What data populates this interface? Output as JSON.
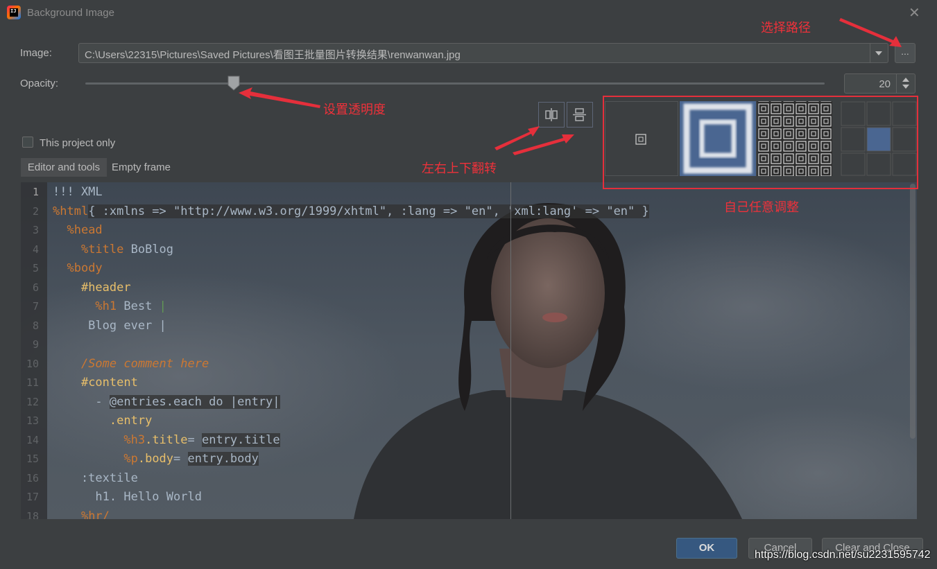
{
  "window": {
    "title": "Background Image",
    "app_icon": "intellij-logo",
    "app_icon_text": "IJ",
    "close_glyph": "✕"
  },
  "image": {
    "label": "Image:",
    "path": "C:\\Users\\22315\\Pictures\\Saved Pictures\\看图王批量图片转换结果\\renwanwan.jpg",
    "browse_label": "..."
  },
  "opacity": {
    "label": "Opacity:",
    "value": "20",
    "slider_fraction": 0.2
  },
  "flip": {
    "horizontal_icon": "flip-horizontal-icon",
    "vertical_icon": "flip-vertical-icon"
  },
  "fill_modes": [
    "center",
    "scale",
    "tile",
    "plain-grid"
  ],
  "annotations": {
    "select_path": "选择路径",
    "set_opacity": "设置透明度",
    "flip": "左右上下翻转",
    "adjust": "自己任意调整"
  },
  "project_only": {
    "label": "This project only",
    "checked": false
  },
  "tabs": {
    "editor": "Editor and tools",
    "frame": "Empty frame"
  },
  "code_lines": [
    {
      "n": "1",
      "segments": [
        {
          "t": "!!! XML",
          "c": "c-default"
        }
      ]
    },
    {
      "n": "2",
      "segments": [
        {
          "t": "%html",
          "c": "c-pct"
        },
        {
          "t": "{ :xmlns => \"http://www.w3.org/1999/xhtml\", :lang => \"en\", 'xml:lang' => \"en\" }",
          "c": "c-default hl"
        }
      ]
    },
    {
      "n": "3",
      "segments": [
        {
          "t": "  ",
          "c": "c-default"
        },
        {
          "t": "%head",
          "c": "c-pct"
        }
      ]
    },
    {
      "n": "4",
      "segments": [
        {
          "t": "    ",
          "c": "c-default"
        },
        {
          "t": "%title",
          "c": "c-pct"
        },
        {
          "t": " BoBlog",
          "c": "c-default"
        }
      ]
    },
    {
      "n": "5",
      "segments": [
        {
          "t": "  ",
          "c": "c-default"
        },
        {
          "t": "%body",
          "c": "c-pct"
        }
      ]
    },
    {
      "n": "6",
      "segments": [
        {
          "t": "    ",
          "c": "c-default"
        },
        {
          "t": "#header",
          "c": "c-tag"
        }
      ]
    },
    {
      "n": "7",
      "segments": [
        {
          "t": "      ",
          "c": "c-default"
        },
        {
          "t": "%h1",
          "c": "c-pct"
        },
        {
          "t": " Best ",
          "c": "c-default"
        },
        {
          "t": "|",
          "c": "c-green"
        }
      ]
    },
    {
      "n": "8",
      "segments": [
        {
          "t": "     Blog ever ",
          "c": "c-default"
        },
        {
          "t": "|",
          "c": "c-default"
        }
      ]
    },
    {
      "n": "9",
      "segments": [
        {
          "t": "",
          "c": "c-default"
        }
      ]
    },
    {
      "n": "10",
      "segments": [
        {
          "t": "    ",
          "c": "c-default"
        },
        {
          "t": "/Some comment here",
          "c": "c-cmt2"
        }
      ]
    },
    {
      "n": "11",
      "segments": [
        {
          "t": "    ",
          "c": "c-default"
        },
        {
          "t": "#content",
          "c": "c-tag"
        }
      ]
    },
    {
      "n": "12",
      "segments": [
        {
          "t": "      - ",
          "c": "c-default"
        },
        {
          "t": "@entries.each do |entry|",
          "c": "c-default hl"
        }
      ]
    },
    {
      "n": "13",
      "segments": [
        {
          "t": "        ",
          "c": "c-default"
        },
        {
          "t": ".entry",
          "c": "c-tag"
        }
      ]
    },
    {
      "n": "14",
      "segments": [
        {
          "t": "          ",
          "c": "c-default"
        },
        {
          "t": "%h3",
          "c": "c-pct"
        },
        {
          "t": ".title",
          "c": "c-tag"
        },
        {
          "t": "= ",
          "c": "c-default"
        },
        {
          "t": "entry.title",
          "c": "c-default hl"
        }
      ]
    },
    {
      "n": "15",
      "segments": [
        {
          "t": "          ",
          "c": "c-default"
        },
        {
          "t": "%p",
          "c": "c-pct"
        },
        {
          "t": ".body",
          "c": "c-tag"
        },
        {
          "t": "= ",
          "c": "c-default"
        },
        {
          "t": "entry.body",
          "c": "c-default hl"
        }
      ]
    },
    {
      "n": "16",
      "segments": [
        {
          "t": "    :textile",
          "c": "c-default"
        }
      ]
    },
    {
      "n": "17",
      "segments": [
        {
          "t": "      h1. Hello World",
          "c": "c-default"
        }
      ]
    },
    {
      "n": "18",
      "segments": [
        {
          "t": "    ",
          "c": "c-default"
        },
        {
          "t": "%hr/",
          "c": "c-pct"
        }
      ]
    }
  ],
  "buttons": {
    "ok": "OK",
    "cancel": "Cancel",
    "clear_close": "Clear and Close"
  },
  "watermark": "https://blog.csdn.net/su2231595742",
  "colors": {
    "dialog_bg": "#3c3f41",
    "accent": "#365880",
    "annotation_red": "#e52f3b",
    "selected_mode": "#4a6691"
  }
}
